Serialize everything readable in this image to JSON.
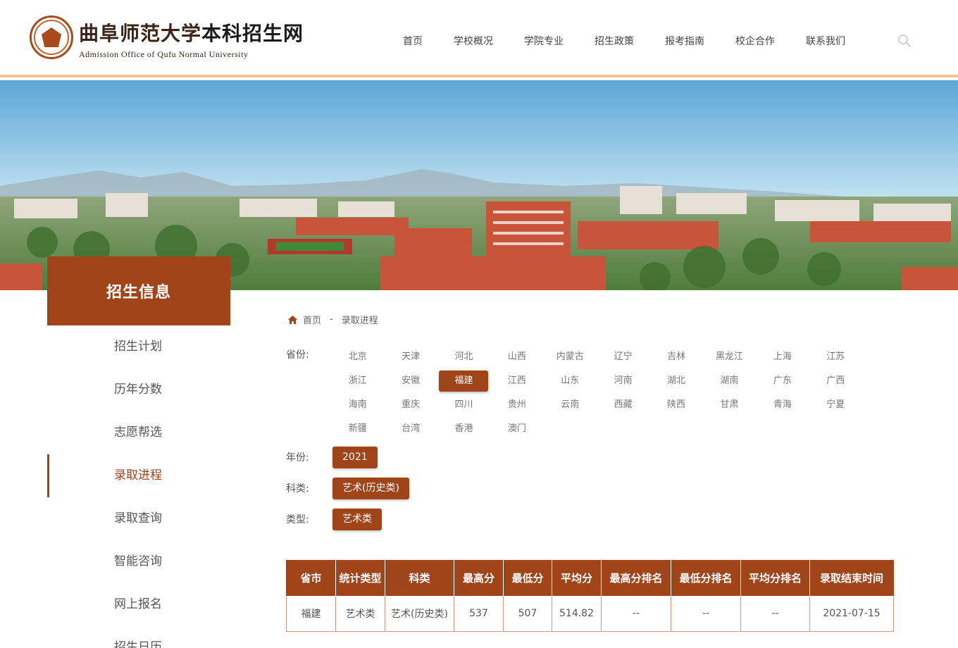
{
  "brand": {
    "name_cn": "曲阜师范大学",
    "name_suffix": "本科招生网",
    "name_en": "Admission Office of Qufu Normal University"
  },
  "nav": {
    "items": [
      "首页",
      "学校概况",
      "学院专业",
      "招生政策",
      "报考指南",
      "校企合作",
      "联系我们"
    ]
  },
  "sidebar": {
    "title": "招生信息",
    "items": [
      "招生计划",
      "历年分数",
      "志愿帮选",
      "录取进程",
      "录取查询",
      "智能咨询",
      "网上报名",
      "招生日历"
    ],
    "active_index": 3
  },
  "breadcrumb": {
    "home": "首页",
    "separator": "-",
    "current": "录取进程"
  },
  "filters": {
    "province_label": "省份:",
    "provinces": [
      "北京",
      "天津",
      "河北",
      "山西",
      "内蒙古",
      "辽宁",
      "吉林",
      "黑龙江",
      "上海",
      "江苏",
      "浙江",
      "安徽",
      "福建",
      "江西",
      "山东",
      "河南",
      "湖北",
      "湖南",
      "广东",
      "广西",
      "海南",
      "重庆",
      "四川",
      "贵州",
      "云南",
      "西藏",
      "陕西",
      "甘肃",
      "青海",
      "宁夏",
      "新疆",
      "台湾",
      "香港",
      "澳门"
    ],
    "selected_province": "福建",
    "year_label": "年份:",
    "year_value": "2021",
    "subject_label": "科类:",
    "subject_value": "艺术(历史类)",
    "type_label": "类型:",
    "type_value": "艺术类"
  },
  "table": {
    "headers": [
      "省市",
      "统计类型",
      "科类",
      "最高分",
      "最低分",
      "平均分",
      "最高分排名",
      "最低分排名",
      "平均分排名",
      "录取结束时间"
    ],
    "rows": [
      [
        "福建",
        "艺术类",
        "艺术(历史类)",
        "537",
        "507",
        "514.82",
        "--",
        "--",
        "--",
        "2021-07-15"
      ]
    ]
  },
  "colors": {
    "accent": "#a0441a",
    "header_border": "#f0c98a"
  },
  "icons": {
    "search": "search-icon",
    "home": "home-icon"
  }
}
